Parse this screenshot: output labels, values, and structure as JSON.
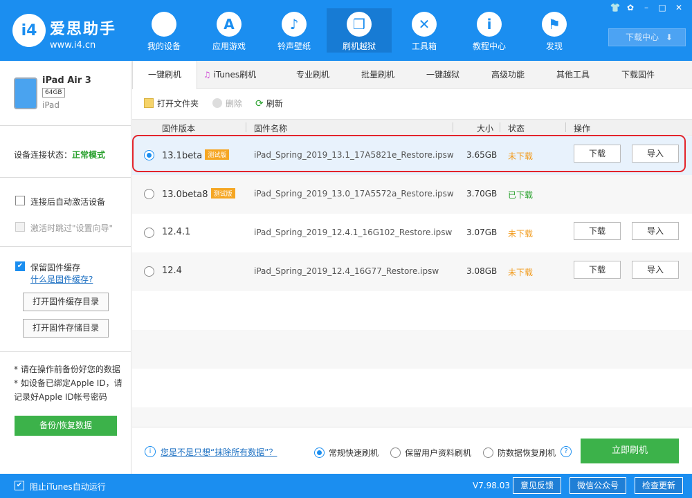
{
  "brand": {
    "logo": "i4",
    "name": "爱思助手",
    "url": "www.i4.cn"
  },
  "nav": [
    {
      "label": "我的设备",
      "icon": "apple-icon",
      "glyph": ""
    },
    {
      "label": "应用游戏",
      "icon": "app-store-icon",
      "glyph": "A"
    },
    {
      "label": "铃声壁纸",
      "icon": "music-icon",
      "glyph": "♪"
    },
    {
      "label": "刷机越狱",
      "icon": "box-icon",
      "glyph": "❒"
    },
    {
      "label": "工具箱",
      "icon": "tools-icon",
      "glyph": "✕"
    },
    {
      "label": "教程中心",
      "icon": "info-icon",
      "glyph": "i"
    },
    {
      "label": "发现",
      "icon": "flag-icon",
      "glyph": "⚑"
    }
  ],
  "window_controls": {
    "shirt": "👕",
    "settings": "✿",
    "minimize": "–",
    "maximize": "□",
    "close": "✕"
  },
  "download_center": {
    "label": "下载中心",
    "arrow": "⬇"
  },
  "device": {
    "name": "iPad Air 3",
    "capacity": "64GB",
    "type": "iPad"
  },
  "connection": {
    "label": "设备连接状态：",
    "status": "正常模式"
  },
  "options": {
    "auto_activate": "连接后自动激活设备",
    "skip_setup": "激活时跳过\"设置向导\"",
    "keep_cache": "保留固件缓存",
    "what_cache": "什么是固件缓存?",
    "check": "✔"
  },
  "left_buttons": {
    "open_cache": "打开固件缓存目录",
    "open_storage": "打开固件存储目录"
  },
  "notes": [
    "* 请在操作前备份好您的数据",
    "* 如设备已绑定Apple ID，请记录好Apple ID帐号密码"
  ],
  "backup_button": "备份/恢复数据",
  "tabs": [
    "一键刷机",
    "iTunes刷机",
    "专业刷机",
    "批量刷机",
    "一键越狱",
    "高级功能",
    "其他工具",
    "下载固件"
  ],
  "toolbar": {
    "open_folder": "打开文件夹",
    "delete": "删除",
    "refresh": "刷新"
  },
  "table": {
    "headers": {
      "version": "固件版本",
      "name": "固件名称",
      "size": "大小",
      "status": "状态",
      "action": "操作"
    },
    "beta_label": "测试版",
    "rows": [
      {
        "version": "13.1beta",
        "beta": true,
        "name": "iPad_Spring_2019_13.1_17A5821e_Restore.ipsw",
        "size": "3.65GB",
        "status": "未下载",
        "download": "下载",
        "import": "导入"
      },
      {
        "version": "13.0beta8",
        "beta": true,
        "name": "iPad_Spring_2019_13.0_17A5572a_Restore.ipsw",
        "size": "3.70GB",
        "status": "已下载",
        "download": "",
        "import": ""
      },
      {
        "version": "12.4.1",
        "beta": false,
        "name": "iPad_Spring_2019_12.4.1_16G102_Restore.ipsw",
        "size": "3.07GB",
        "status": "未下载",
        "download": "下载",
        "import": "导入"
      },
      {
        "version": "12.4",
        "beta": false,
        "name": "iPad_Spring_2019_12.4_16G77_Restore.ipsw",
        "size": "3.08GB",
        "status": "未下载",
        "download": "下载",
        "import": "导入"
      }
    ]
  },
  "bottom": {
    "info_icon": "i",
    "erase_link": "您是不是只想“抹除所有数据”？",
    "mode_normal": "常规快速刷机",
    "mode_keep": "保留用户资料刷机",
    "mode_anti": "防数据恢复刷机",
    "help": "?",
    "flash_button": "立即刷机"
  },
  "status_bar": {
    "block_itunes": "阻止iTunes自动运行",
    "version": "V7.98.03",
    "feedback": "意见反馈",
    "wechat": "微信公众号",
    "update": "检查更新"
  }
}
